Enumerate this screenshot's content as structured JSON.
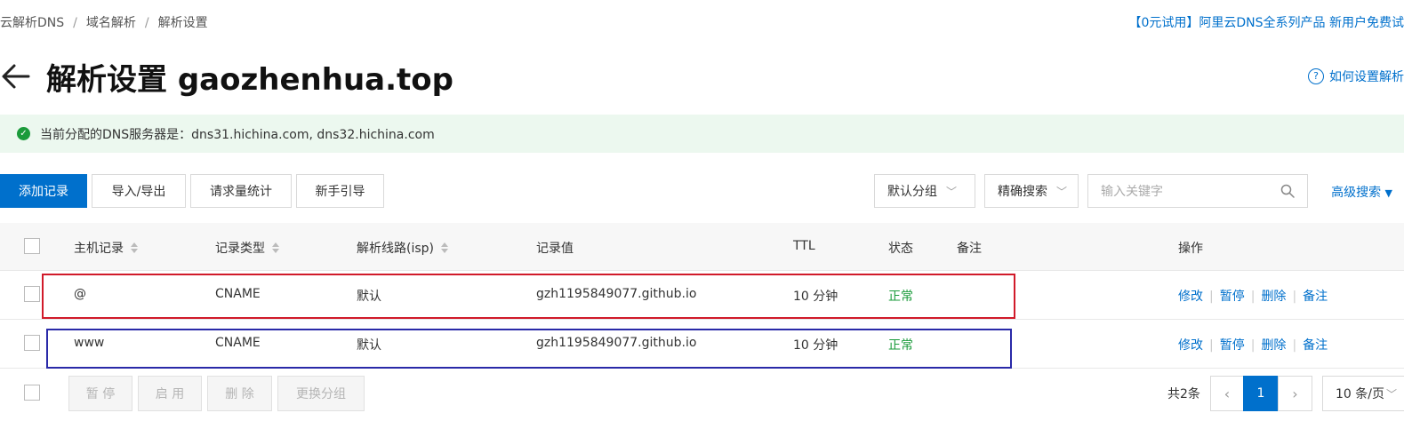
{
  "breadcrumb": [
    "云解析DNS",
    "域名解析",
    "解析设置"
  ],
  "promo_text": "【0元试用】阿里云DNS全系列产品 新用户免费试",
  "page_title": "解析设置 gaozhenhua.top",
  "help_link": "如何设置解析",
  "dns_notice": "当前分配的DNS服务器是：dns31.hichina.com, dns32.hichina.com",
  "toolbar": {
    "add_record": "添加记录",
    "import_export": "导入/导出",
    "request_stats": "请求量统计",
    "beginner_guide": "新手引导",
    "group_select": "默认分组",
    "search_mode": "精确搜索",
    "search_placeholder": "输入关键字",
    "advanced_search": "高级搜索"
  },
  "table": {
    "columns": {
      "host": "主机记录",
      "type": "记录类型",
      "line": "解析线路(isp)",
      "value": "记录值",
      "ttl": "TTL",
      "status": "状态",
      "remark": "备注",
      "ops": "操作"
    },
    "rows": [
      {
        "host": "@",
        "type": "CNAME",
        "line": "默认",
        "value": "gzh1195849077.github.io",
        "ttl": "10 分钟",
        "status": "正常",
        "remark": ""
      },
      {
        "host": "www",
        "type": "CNAME",
        "line": "默认",
        "value": "gzh1195849077.github.io",
        "ttl": "10 分钟",
        "status": "正常",
        "remark": ""
      }
    ],
    "row_actions": [
      "修改",
      "暂停",
      "删除",
      "备注"
    ]
  },
  "footer": {
    "bulk_actions": [
      "暂 停",
      "启 用",
      "删 除",
      "更换分组"
    ],
    "total": "共2条",
    "current_page": "1",
    "page_size": "10 条/页"
  },
  "colors": {
    "primary": "#0070cc",
    "success": "#1b9b3b",
    "notice_bg": "#ecf8ef",
    "highlight_red": "#d11a2a",
    "highlight_blue": "#2a2aa8"
  }
}
